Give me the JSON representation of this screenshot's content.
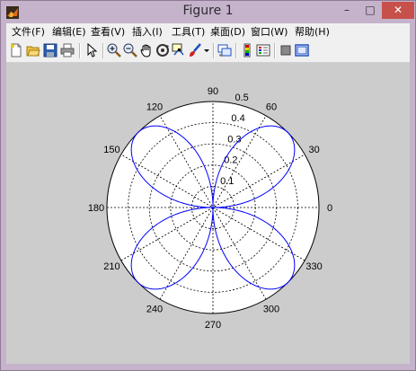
{
  "window": {
    "title": "Figure 1",
    "controls": {
      "minimize": "–",
      "maximize": "□",
      "close": "✕"
    }
  },
  "menu": {
    "items": [
      {
        "label": "文件(F)"
      },
      {
        "label": "编辑(E)"
      },
      {
        "label": "查看(V)"
      },
      {
        "label": "插入(I)"
      },
      {
        "label": "工具(T)"
      },
      {
        "label": "桌面(D)"
      },
      {
        "label": "窗口(W)"
      },
      {
        "label": "帮助(H)"
      }
    ]
  },
  "toolbar": {
    "icons": [
      "new-figure-icon",
      "open-file-icon",
      "save-icon",
      "print-icon",
      "edit-plot-arrow-icon",
      "zoom-in-icon",
      "zoom-out-icon",
      "pan-hand-icon",
      "rotate-3d-icon",
      "data-cursor-icon",
      "brush-icon",
      "brush-dropdown-icon",
      "link-plot-icon",
      "insert-colorbar-icon",
      "insert-legend-icon",
      "hide-plot-tools-icon",
      "show-plot-tools-icon"
    ]
  },
  "colors": {
    "curve": "#0000ff",
    "grid": "#000000",
    "axes_bg": "#ffffff",
    "figure_bg": "#cccccc"
  },
  "chart_data": {
    "type": "polar",
    "title": "",
    "r_ticks": [
      "0.1",
      "0.2",
      "0.3",
      "0.4",
      "0.5"
    ],
    "r_max": 0.5,
    "theta_ticks": [
      "0",
      "30",
      "60",
      "90",
      "120",
      "150",
      "180",
      "210",
      "240",
      "270",
      "300",
      "330"
    ],
    "grid": true,
    "series": [
      {
        "expression": "r = 0.5·|sin(2θ)|",
        "color": "#0000ff",
        "peak_r": 0.5,
        "peak_angles_deg": [
          45,
          135,
          225,
          315
        ]
      }
    ]
  }
}
